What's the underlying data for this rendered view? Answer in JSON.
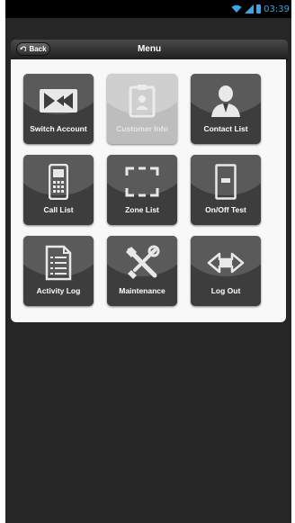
{
  "statusbar": {
    "time": "03:39",
    "accent_color": "#3aa6e6"
  },
  "header": {
    "back_label": "Back",
    "title": "Menu"
  },
  "menu": {
    "items": [
      {
        "label": "Switch Account",
        "icon": "switch-arrows-icon",
        "enabled": true
      },
      {
        "label": "Customer Info",
        "icon": "id-badge-icon",
        "enabled": false
      },
      {
        "label": "Contact List",
        "icon": "person-icon",
        "enabled": true
      },
      {
        "label": "Call List",
        "icon": "phone-icon",
        "enabled": true
      },
      {
        "label": "Zone List",
        "icon": "zone-bracket-icon",
        "enabled": true
      },
      {
        "label": "On/Off Test",
        "icon": "switch-toggle-icon",
        "enabled": true
      },
      {
        "label": "Activity Log",
        "icon": "document-icon",
        "enabled": true
      },
      {
        "label": "Maintenance",
        "icon": "tools-icon",
        "enabled": true
      },
      {
        "label": "Log Out",
        "icon": "logout-arrows-icon",
        "enabled": true
      }
    ]
  }
}
